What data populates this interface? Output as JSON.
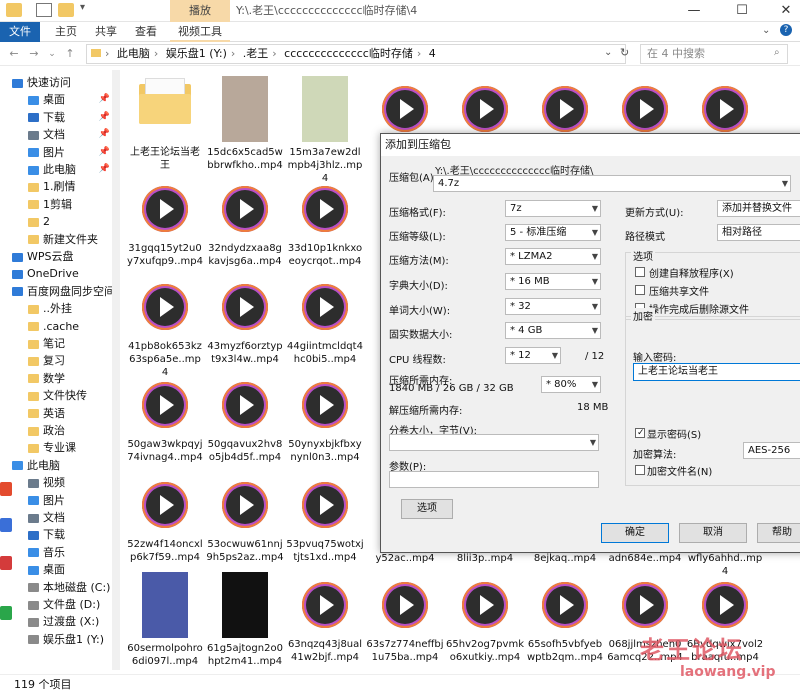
{
  "window": {
    "title": "Y:\\.老王\\cccccccccccccc临时存储\\4",
    "context_tab": "播放",
    "controls": {
      "minimize": "—",
      "maximize": "☐",
      "close": "✕"
    }
  },
  "ribbon": {
    "tabs": [
      "文件",
      "主页",
      "共享",
      "查看",
      "视频工具"
    ]
  },
  "address": {
    "crumbs": [
      "此电脑",
      "娱乐盘1 (Y:)",
      ".老王",
      "cccccccccccccc临时存储",
      "4"
    ],
    "search_placeholder": "在 4 中搜索"
  },
  "sidebar": {
    "items": [
      {
        "label": "快速访问",
        "icon": "star-icon",
        "color": "#2f7bd8",
        "pin": false,
        "indent": 0
      },
      {
        "label": "桌面",
        "icon": "desktop-icon",
        "color": "#3a8ee6",
        "pin": true,
        "indent": 1
      },
      {
        "label": "下载",
        "icon": "download-icon",
        "color": "#2d6fc7",
        "pin": true,
        "indent": 1
      },
      {
        "label": "文档",
        "icon": "document-icon",
        "color": "#6b7b8c",
        "pin": true,
        "indent": 1
      },
      {
        "label": "图片",
        "icon": "picture-icon",
        "color": "#3a8ee6",
        "pin": true,
        "indent": 1
      },
      {
        "label": "此电脑",
        "icon": "computer-icon",
        "color": "#3a8ee6",
        "pin": true,
        "indent": 1
      },
      {
        "label": "1.刷情",
        "icon": "folder-icon",
        "color": "#f2c865",
        "pin": false,
        "indent": 1
      },
      {
        "label": "1剪辑",
        "icon": "folder-icon",
        "color": "#f2c865",
        "pin": false,
        "indent": 1
      },
      {
        "label": "2",
        "icon": "folder-icon",
        "color": "#f2c865",
        "pin": false,
        "indent": 1
      },
      {
        "label": "新建文件夹",
        "icon": "folder-icon",
        "color": "#f2c865",
        "pin": false,
        "indent": 1
      },
      {
        "label": "WPS云盘",
        "icon": "cloud-icon",
        "color": "#2f7bd8",
        "pin": false,
        "indent": 0
      },
      {
        "label": "OneDrive",
        "icon": "cloud-icon",
        "color": "#2f7bd8",
        "pin": false,
        "indent": 0
      },
      {
        "label": "百度网盘同步空间",
        "icon": "cloud-icon",
        "color": "#2f7bd8",
        "pin": false,
        "indent": 0
      },
      {
        "label": "..外挂",
        "icon": "folder-icon",
        "color": "#f2c865",
        "pin": false,
        "indent": 1
      },
      {
        "label": ".cache",
        "icon": "folder-icon",
        "color": "#f2c865",
        "pin": false,
        "indent": 1
      },
      {
        "label": "笔记",
        "icon": "folder-icon",
        "color": "#f2c865",
        "pin": false,
        "indent": 1
      },
      {
        "label": "复习",
        "icon": "folder-icon",
        "color": "#f2c865",
        "pin": false,
        "indent": 1
      },
      {
        "label": "数学",
        "icon": "folder-icon",
        "color": "#f2c865",
        "pin": false,
        "indent": 1
      },
      {
        "label": "文件快传",
        "icon": "folder-icon",
        "color": "#f2c865",
        "pin": false,
        "indent": 1
      },
      {
        "label": "英语",
        "icon": "folder-icon",
        "color": "#f2c865",
        "pin": false,
        "indent": 1
      },
      {
        "label": "政治",
        "icon": "folder-icon",
        "color": "#f2c865",
        "pin": false,
        "indent": 1
      },
      {
        "label": "专业课",
        "icon": "folder-icon",
        "color": "#f2c865",
        "pin": false,
        "indent": 1
      },
      {
        "label": "此电脑",
        "icon": "computer-icon",
        "color": "#3a8ee6",
        "pin": false,
        "indent": 0
      },
      {
        "label": "视频",
        "icon": "video-icon",
        "color": "#6b7b8c",
        "pin": false,
        "indent": 1
      },
      {
        "label": "图片",
        "icon": "picture-icon",
        "color": "#3a8ee6",
        "pin": false,
        "indent": 1
      },
      {
        "label": "文档",
        "icon": "document-icon",
        "color": "#6b7b8c",
        "pin": false,
        "indent": 1
      },
      {
        "label": "下载",
        "icon": "download-icon",
        "color": "#2d6fc7",
        "pin": false,
        "indent": 1
      },
      {
        "label": "音乐",
        "icon": "music-icon",
        "color": "#3a8ee6",
        "pin": false,
        "indent": 1
      },
      {
        "label": "桌面",
        "icon": "desktop-icon",
        "color": "#3a8ee6",
        "pin": false,
        "indent": 1
      },
      {
        "label": "本地磁盘 (C:)",
        "icon": "drive-icon",
        "color": "#8a8a8a",
        "pin": false,
        "indent": 1
      },
      {
        "label": "文件盘 (D:)",
        "icon": "drive-icon",
        "color": "#8a8a8a",
        "pin": false,
        "indent": 1
      },
      {
        "label": "过渡盘 (X:)",
        "icon": "drive-icon",
        "color": "#8a8a8a",
        "pin": false,
        "indent": 1
      },
      {
        "label": "娱乐盘1 (Y:)",
        "icon": "drive-icon",
        "color": "#8a8a8a",
        "pin": false,
        "indent": 1
      }
    ]
  },
  "files": [
    {
      "name": "上老王论坛当老王",
      "kind": "folder"
    },
    {
      "name": "15dc6x5cad5wbbrwfkho..mp4",
      "kind": "photo",
      "color": "#b8a89a"
    },
    {
      "name": "15m3a7ew2dlmpb4j3hlz..mp4",
      "kind": "photo",
      "color": "#cfd8b8"
    },
    {
      "name": "",
      "kind": "video"
    },
    {
      "name": "",
      "kind": "video"
    },
    {
      "name": "",
      "kind": "video"
    },
    {
      "name": "",
      "kind": "video"
    },
    {
      "name": "",
      "kind": "video"
    },
    {
      "name": "31gqq15yt2u0y7xufqp9..mp4",
      "kind": "video"
    },
    {
      "name": "32ndydzxaa8gkavjsg6a..mp4",
      "kind": "video"
    },
    {
      "name": "33d10p1knkxoeoycrqot..mp4",
      "kind": "video"
    },
    {
      "name": "41pb8ok653kz63sp6a5e..mp4",
      "kind": "video"
    },
    {
      "name": "43myzf6orztypt9x3l4w..mp4",
      "kind": "video"
    },
    {
      "name": "44giintmcldqt4hc0bi5..mp4",
      "kind": "video"
    },
    {
      "name": "50gaw3wkpqyj74ivnag4..mp4",
      "kind": "video"
    },
    {
      "name": "50gqavux2hv8o5jb4d5f..mp4",
      "kind": "video"
    },
    {
      "name": "50ynyxbjkfbxynynl0n3..mp4",
      "kind": "video"
    },
    {
      "name": "52zw4f14oncxlp6k7f59..mp4",
      "kind": "video"
    },
    {
      "name": "53ocwuw61nnj9h5ps2az..mp4",
      "kind": "video"
    },
    {
      "name": "53pvuq75wotxjtjts1xd..mp4",
      "kind": "video"
    },
    {
      "name": "y52ac..mp4",
      "kind": "text"
    },
    {
      "name": "8lii3p..mp4",
      "kind": "text"
    },
    {
      "name": "8ejkaq..mp4",
      "kind": "text"
    },
    {
      "name": "adn684e..mp4",
      "kind": "text"
    },
    {
      "name": "wfly6ahhd..mp4",
      "kind": "text"
    },
    {
      "name": "60sermolpohro6di097l..mp4",
      "kind": "photo",
      "color": "#4a5aa8"
    },
    {
      "name": "61g5ajtogn2o0hpt2m41..mp4",
      "kind": "photo",
      "color": "#111111"
    },
    {
      "name": "63nqzq43j8ual41w2bjf..mp4",
      "kind": "video"
    },
    {
      "name": "63s7z774neffbj1u75ba..mp4",
      "kind": "video"
    },
    {
      "name": "65hv2og7pvmko6xutkiy..mp4",
      "kind": "video"
    },
    {
      "name": "65sofh5vbfyebwptb2qm..mp4",
      "kind": "video"
    },
    {
      "name": "068jjlmszhen06amcq22..mp4",
      "kind": "video"
    },
    {
      "name": "6Bvdqwix7vol2braaqfu..mp4",
      "kind": "video"
    }
  ],
  "status": {
    "count": "119 个项目"
  },
  "dialog": {
    "title": "添加到压缩包",
    "archive_label": "压缩包(A):",
    "archive_path": "Y:\\.老王\\cccccccccccccc临时存储\\",
    "archive_name": "4.7z",
    "format_label": "压缩格式(F):",
    "format_value": "7z",
    "level_label": "压缩等级(L):",
    "level_value": "5 - 标准压缩",
    "method_label": "压缩方法(M):",
    "method_value": "* LZMA2",
    "dict_label": "字典大小(D):",
    "dict_value": "* 16 MB",
    "word_label": "单词大小(W):",
    "word_value": "* 32",
    "solid_label": "固实数据大小:",
    "solid_value": "* 4 GB",
    "cpu_label": "CPU 线程数:",
    "cpu_value": "* 12",
    "cpu_max": "/ 12",
    "mem_label": "压缩所需内存:",
    "mem_detail": "1840 MB / 26 GB / 32 GB",
    "mem_value": "* 80%",
    "decomp_label": "解压缩所需内存:",
    "decomp_value": "18 MB",
    "split_label": "分卷大小，字节(V):",
    "params_label": "参数(P):",
    "options_button": "选项",
    "update_label": "更新方式(U):",
    "update_value": "添加并替换文件",
    "path_label": "路径模式",
    "path_value": "相对路径",
    "options_group": "选项",
    "opt_sfx": "创建自释放程序(X)",
    "opt_shared": "压缩共享文件",
    "opt_delete": "操作完成后删除源文件",
    "encrypt_group": "加密",
    "password_label": "输入密码:",
    "password_value": "上老王论坛当老王",
    "show_password": "显示密码(S)",
    "enc_method_label": "加密算法:",
    "enc_method_value": "AES-256",
    "encrypt_names": "加密文件名(N)",
    "ok": "确定",
    "cancel": "取消",
    "help": "帮助"
  },
  "watermark": {
    "line1": "老王论坛",
    "line2": "laowang.vip"
  }
}
